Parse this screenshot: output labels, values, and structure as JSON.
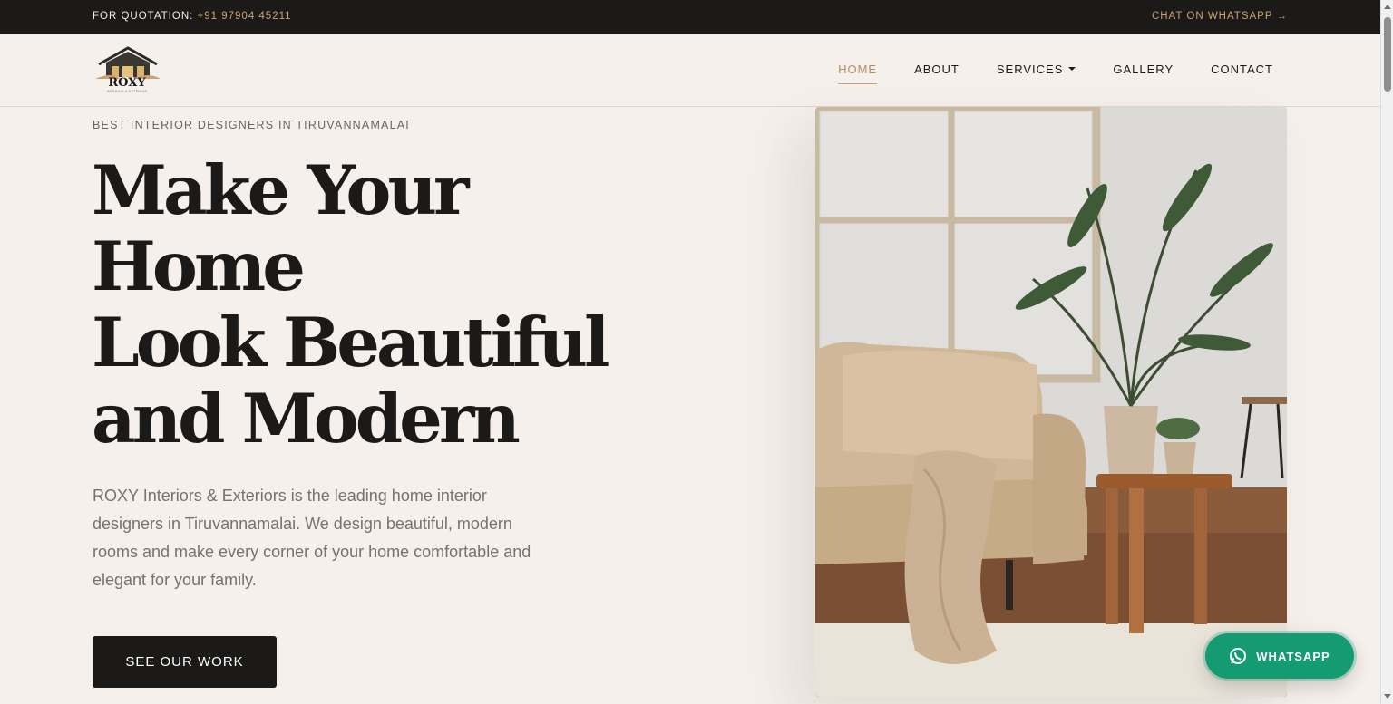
{
  "topbar": {
    "quotation_label": "FOR QUOTATION:",
    "phone": "+91 97904 45211",
    "chat_link": "CHAT ON WHATSAPP →"
  },
  "logo": {
    "name": "ROXY",
    "tagline": "INTERIOR & EXTERIOR"
  },
  "nav": {
    "items": [
      {
        "label": "HOME",
        "active": true
      },
      {
        "label": "ABOUT"
      },
      {
        "label": "SERVICES",
        "dropdown": true
      },
      {
        "label": "GALLERY"
      },
      {
        "label": "CONTACT"
      }
    ]
  },
  "hero": {
    "eyebrow": "BEST INTERIOR DESIGNERS IN TIRUVANNAMALAI",
    "headline_lines": [
      "Make Your",
      "Home",
      "Look Beautiful",
      "and Modern"
    ],
    "description": "ROXY Interiors & Exteriors is the leading home interior designers in Tiruvannamalai. We design beautiful, modern rooms and make every corner of your home comfortable and elegant for your family.",
    "cta_label": "SEE OUR WORK",
    "image_icon": "living-room-photo"
  },
  "whatsapp_button": {
    "label": "WHATSAPP",
    "icon": "whatsapp-icon"
  },
  "colors": {
    "background": "#f5f0ec",
    "dark": "#1b1a19",
    "accent": "#c9a472",
    "whatsapp_green": "#159b72"
  }
}
